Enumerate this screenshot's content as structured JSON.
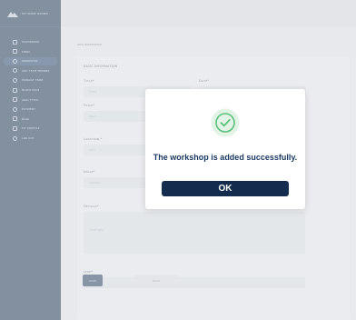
{
  "brand": {
    "name": "ᴍʏ ɴʌᴍᴇ ʙʀʌɴᴅ"
  },
  "sidebar": {
    "items": [
      {
        "label": "ᴅᴀsʜʙᴏᴀʀᴅ",
        "icon": "grid-icon",
        "active": false
      },
      {
        "label": "ᴍᴇɴᴜ",
        "icon": "list-icon",
        "active": false
      },
      {
        "label": "ᴡᴏʀᴋsʜᴏᴘ",
        "icon": "gear-icon",
        "active": true
      },
      {
        "label": "ᴀᴅᴅ ᴛᴇᴀᴍ ᴍᴇᴍʙᴇʀ",
        "icon": "user-plus-icon",
        "active": false
      },
      {
        "label": "ᴍᴀɴᴀɢᴇ ᴛᴇᴀᴍ",
        "icon": "users-icon",
        "active": false
      },
      {
        "label": "ʙʟᴏᴄᴋ ᴘᴀɢᴇ",
        "icon": "block-icon",
        "active": false
      },
      {
        "label": "ᴀɴᴀʟʏᴛɪᴄs",
        "icon": "chart-icon",
        "active": false
      },
      {
        "label": "ᴘᴀʏᴍᴇɴᴛ",
        "icon": "card-icon",
        "active": false
      },
      {
        "label": "ʙʟᴏɢ",
        "icon": "doc-icon",
        "active": false
      },
      {
        "label": "ᴍʏ ᴘʀᴏғɪʟᴇ",
        "icon": "profile-icon",
        "active": false
      },
      {
        "label": "ʟᴏɢ ᴏᴜᴛ",
        "icon": "logout-icon",
        "active": false
      }
    ]
  },
  "main": {
    "breadcrumb": "ᴀᴅᴅ ᴡᴏʀᴋsʜᴏᴘ",
    "section_title": "ʙᴀsɪᴄ ɪɴғᴏʀᴍᴀᴛɪᴏɴ",
    "fields": {
      "title_label": "Tɪᴛʟᴇ*",
      "title_placeholder": "ᴛɪᴛʟᴇ",
      "date_label": "Dᴀᴛᴇ*",
      "price_label": "Pʀɪᴄᴇ*",
      "price_placeholder": "ᴘʀɪᴄᴇ",
      "location_label": "Lᴏᴄᴀᴛɪᴏɴ *",
      "location_placeholder": "ᴄɪᴛʏ",
      "image_label": "Iᴍᴀɢᴇ*",
      "image_placeholder": "ᴄʜᴏᴏsᴇ",
      "details_label": "Dᴇᴛᴀɪʟs*",
      "details_placeholder": "ᴛʏᴘᴇ ʜᴇʀᴇ",
      "link_label": "Lɪɴᴋ*",
      "link_placeholder": "ʟɪɴᴋ"
    },
    "save_label": "sᴀᴠᴇ",
    "cancel_label": "ʙᴀᴄᴋ"
  },
  "modal": {
    "message": "The workshop is added successfully.",
    "ok_label": "OK",
    "icon": "check-circle-icon"
  },
  "colors": {
    "sidebar_bg": "#0e2a4a",
    "accent": "#142d4f",
    "success": "#5cbf7a"
  }
}
